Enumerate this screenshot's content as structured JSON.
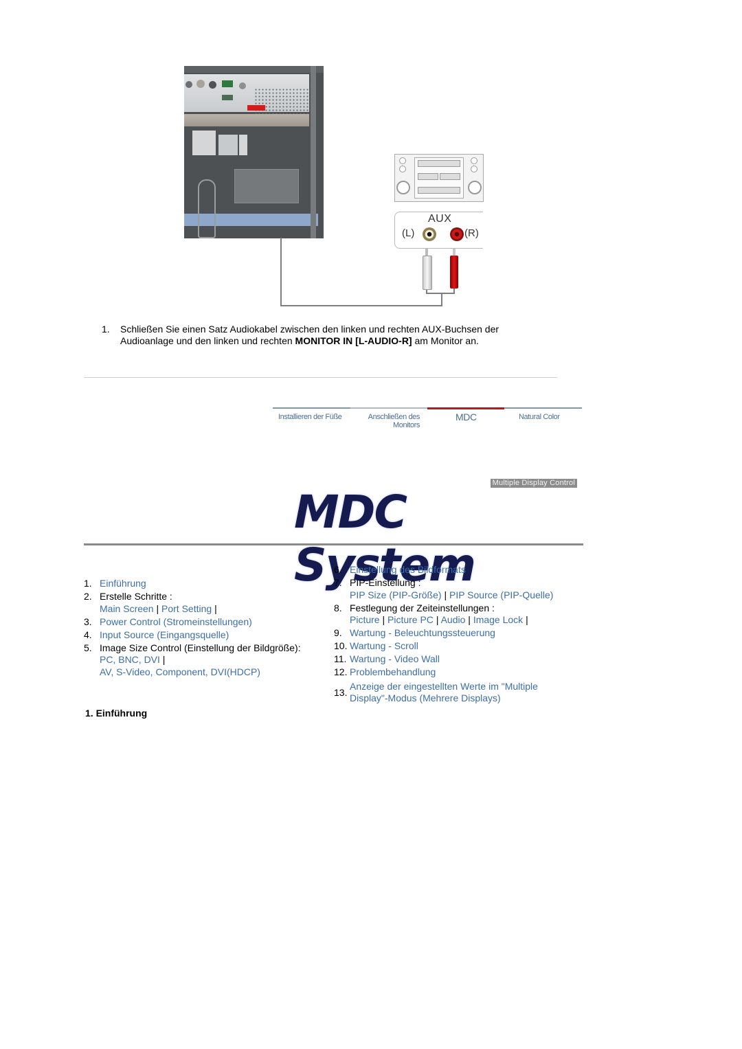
{
  "illustration": {
    "monitor_alt": "monitor-rear-panel-photo",
    "stereo_alt": "audio-system",
    "aux_label": "AUX",
    "left_label": "(L)",
    "right_label": "(R)",
    "colors": {
      "left_jack": "#f4efe0",
      "right_jack": "#c81c1c",
      "cable": "#7e7e7e"
    }
  },
  "instruction": {
    "number": "1.",
    "text_before": "Schließen Sie einen Satz Audiokabel zwischen den linken und rechten AUX-Buchsen der Audioanlage und den linken und rechten ",
    "bold": "MONITOR IN [L-AUDIO-R]",
    "text_after": " am Monitor an."
  },
  "nav": {
    "tabs": [
      {
        "label": "Installieren der Füße",
        "active": false
      },
      {
        "label": "Anschließen des Monitors",
        "active": false
      },
      {
        "label": "MDC",
        "active": true
      },
      {
        "label": "Natural Color",
        "active": false
      }
    ],
    "colors": {
      "line": "#7f98b2",
      "active_line": "#b31b22",
      "text": "#4a6d95"
    }
  },
  "logo": {
    "subtitle": "Multiple Display Control",
    "title": "MDC System"
  },
  "toc": {
    "link_color": "#3d6ea8",
    "left": [
      {
        "n": "1.",
        "link": "Einführung"
      },
      {
        "n": "2.",
        "text": "Erstelle Schritte :",
        "links": [
          "Main Screen",
          "Port Setting"
        ]
      },
      {
        "n": "3.",
        "link": "Power Control (Stromeinstellungen)"
      },
      {
        "n": "4.",
        "link": "Input Source (Eingangsquelle)"
      },
      {
        "n": "5.",
        "text": "Image Size Control (Einstellung der Bildgröße):",
        "links": [
          "PC, BNC, DVI",
          "AV, S-Video, Component, DVI(HDCP)"
        ]
      }
    ],
    "right": [
      {
        "n": "6.",
        "link": "Einstellung des Bildformats"
      },
      {
        "n": "7.",
        "text": "PIP-Einstellung :",
        "links": [
          "PIP Size (PIP-Größe)",
          "PIP Source (PIP-Quelle)"
        ]
      },
      {
        "n": "8.",
        "text": "Festlegung der Zeiteinstellungen :",
        "links": [
          "Picture",
          "Picture PC",
          "Audio",
          "Image Lock"
        ]
      },
      {
        "n": "9.",
        "link": "Wartung - Beleuchtungssteuerung"
      },
      {
        "n": "10.",
        "link": "Wartung - Scroll"
      },
      {
        "n": "11.",
        "link": "Wartung - Video Wall"
      },
      {
        "n": "12.",
        "link": "Problembehandlung"
      },
      {
        "n": "13.",
        "link": "Anzeige der eingestellten Werte im \"Multiple Display\"-Modus (Mehrere Displays)"
      }
    ],
    "separator": "|"
  },
  "section_heading": "1. Einführung"
}
